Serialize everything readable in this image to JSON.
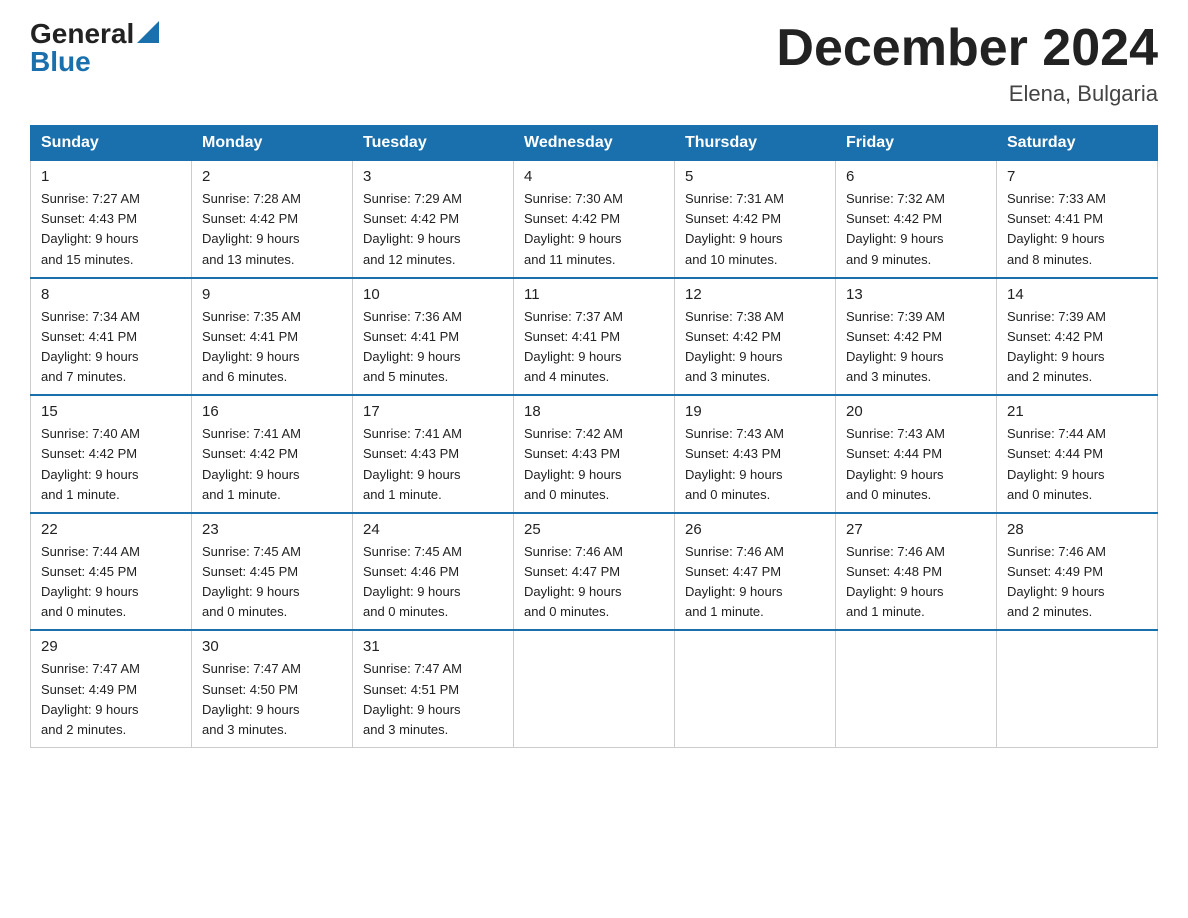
{
  "logo": {
    "general": "General",
    "blue": "Blue",
    "triangle": "▲"
  },
  "title": "December 2024",
  "location": "Elena, Bulgaria",
  "days_of_week": [
    "Sunday",
    "Monday",
    "Tuesday",
    "Wednesday",
    "Thursday",
    "Friday",
    "Saturday"
  ],
  "weeks": [
    [
      {
        "day": "1",
        "sunrise": "7:27 AM",
        "sunset": "4:43 PM",
        "daylight": "9 hours and 15 minutes."
      },
      {
        "day": "2",
        "sunrise": "7:28 AM",
        "sunset": "4:42 PM",
        "daylight": "9 hours and 13 minutes."
      },
      {
        "day": "3",
        "sunrise": "7:29 AM",
        "sunset": "4:42 PM",
        "daylight": "9 hours and 12 minutes."
      },
      {
        "day": "4",
        "sunrise": "7:30 AM",
        "sunset": "4:42 PM",
        "daylight": "9 hours and 11 minutes."
      },
      {
        "day": "5",
        "sunrise": "7:31 AM",
        "sunset": "4:42 PM",
        "daylight": "9 hours and 10 minutes."
      },
      {
        "day": "6",
        "sunrise": "7:32 AM",
        "sunset": "4:42 PM",
        "daylight": "9 hours and 9 minutes."
      },
      {
        "day": "7",
        "sunrise": "7:33 AM",
        "sunset": "4:41 PM",
        "daylight": "9 hours and 8 minutes."
      }
    ],
    [
      {
        "day": "8",
        "sunrise": "7:34 AM",
        "sunset": "4:41 PM",
        "daylight": "9 hours and 7 minutes."
      },
      {
        "day": "9",
        "sunrise": "7:35 AM",
        "sunset": "4:41 PM",
        "daylight": "9 hours and 6 minutes."
      },
      {
        "day": "10",
        "sunrise": "7:36 AM",
        "sunset": "4:41 PM",
        "daylight": "9 hours and 5 minutes."
      },
      {
        "day": "11",
        "sunrise": "7:37 AM",
        "sunset": "4:41 PM",
        "daylight": "9 hours and 4 minutes."
      },
      {
        "day": "12",
        "sunrise": "7:38 AM",
        "sunset": "4:42 PM",
        "daylight": "9 hours and 3 minutes."
      },
      {
        "day": "13",
        "sunrise": "7:39 AM",
        "sunset": "4:42 PM",
        "daylight": "9 hours and 3 minutes."
      },
      {
        "day": "14",
        "sunrise": "7:39 AM",
        "sunset": "4:42 PM",
        "daylight": "9 hours and 2 minutes."
      }
    ],
    [
      {
        "day": "15",
        "sunrise": "7:40 AM",
        "sunset": "4:42 PM",
        "daylight": "9 hours and 1 minute."
      },
      {
        "day": "16",
        "sunrise": "7:41 AM",
        "sunset": "4:42 PM",
        "daylight": "9 hours and 1 minute."
      },
      {
        "day": "17",
        "sunrise": "7:41 AM",
        "sunset": "4:43 PM",
        "daylight": "9 hours and 1 minute."
      },
      {
        "day": "18",
        "sunrise": "7:42 AM",
        "sunset": "4:43 PM",
        "daylight": "9 hours and 0 minutes."
      },
      {
        "day": "19",
        "sunrise": "7:43 AM",
        "sunset": "4:43 PM",
        "daylight": "9 hours and 0 minutes."
      },
      {
        "day": "20",
        "sunrise": "7:43 AM",
        "sunset": "4:44 PM",
        "daylight": "9 hours and 0 minutes."
      },
      {
        "day": "21",
        "sunrise": "7:44 AM",
        "sunset": "4:44 PM",
        "daylight": "9 hours and 0 minutes."
      }
    ],
    [
      {
        "day": "22",
        "sunrise": "7:44 AM",
        "sunset": "4:45 PM",
        "daylight": "9 hours and 0 minutes."
      },
      {
        "day": "23",
        "sunrise": "7:45 AM",
        "sunset": "4:45 PM",
        "daylight": "9 hours and 0 minutes."
      },
      {
        "day": "24",
        "sunrise": "7:45 AM",
        "sunset": "4:46 PM",
        "daylight": "9 hours and 0 minutes."
      },
      {
        "day": "25",
        "sunrise": "7:46 AM",
        "sunset": "4:47 PM",
        "daylight": "9 hours and 0 minutes."
      },
      {
        "day": "26",
        "sunrise": "7:46 AM",
        "sunset": "4:47 PM",
        "daylight": "9 hours and 1 minute."
      },
      {
        "day": "27",
        "sunrise": "7:46 AM",
        "sunset": "4:48 PM",
        "daylight": "9 hours and 1 minute."
      },
      {
        "day": "28",
        "sunrise": "7:46 AM",
        "sunset": "4:49 PM",
        "daylight": "9 hours and 2 minutes."
      }
    ],
    [
      {
        "day": "29",
        "sunrise": "7:47 AM",
        "sunset": "4:49 PM",
        "daylight": "9 hours and 2 minutes."
      },
      {
        "day": "30",
        "sunrise": "7:47 AM",
        "sunset": "4:50 PM",
        "daylight": "9 hours and 3 minutes."
      },
      {
        "day": "31",
        "sunrise": "7:47 AM",
        "sunset": "4:51 PM",
        "daylight": "9 hours and 3 minutes."
      },
      null,
      null,
      null,
      null
    ]
  ]
}
